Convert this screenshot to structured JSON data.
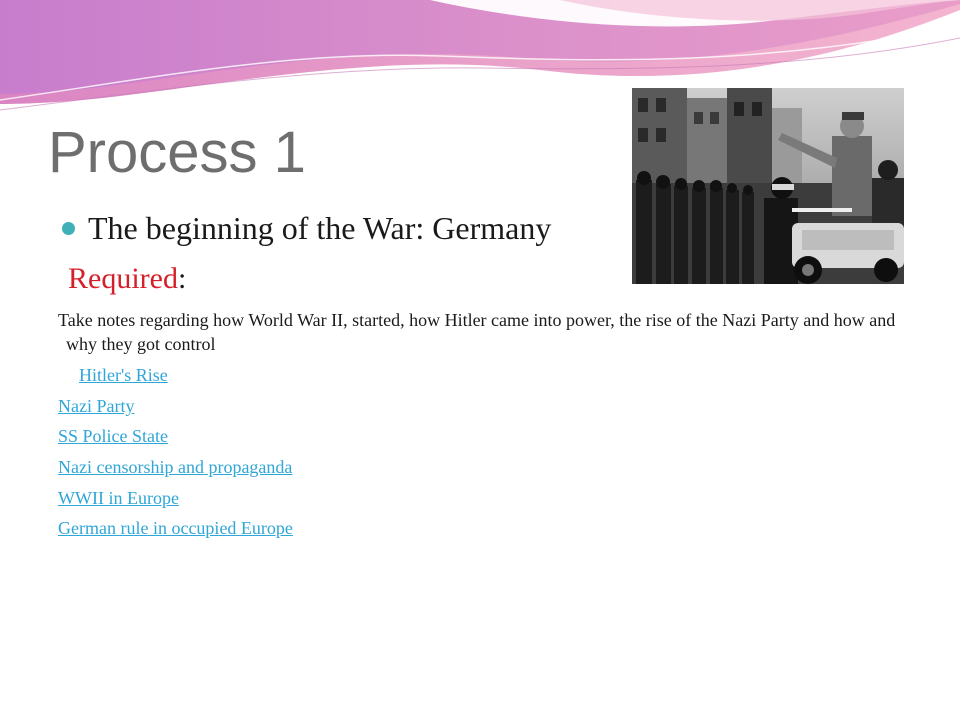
{
  "slide": {
    "title": "Process 1",
    "bullet": "The beginning of the War: Germany",
    "required_label": "Required",
    "required_colon": ":",
    "notes": "Take notes regarding how World War II, started, how Hitler came into power, the rise of the Nazi Party and how and why they got control",
    "links": [
      "Hitler's Rise",
      "Nazi Party",
      "SS Police State",
      "Nazi censorship and propaganda",
      "WWII  in Europe",
      "German rule in occupied Europe"
    ]
  },
  "colors": {
    "title": "#6e6e6e",
    "required": "#d4202a",
    "link": "#2fa6d8",
    "bullet_dot": "#3fb0b6",
    "wave_pink": "#e07bb0",
    "wave_purple": "#c67bd0"
  },
  "icons": {
    "photo": "historical-parade-photo",
    "bullet": "bullet-dot-icon"
  }
}
